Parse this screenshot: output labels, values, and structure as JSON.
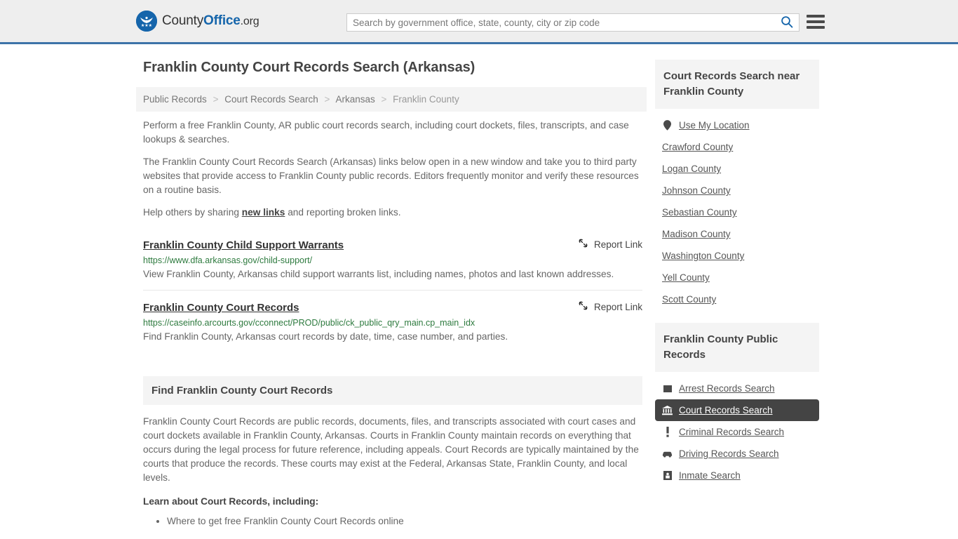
{
  "header": {
    "brand": {
      "part1": "County",
      "part2": "Office",
      "part3": ".org",
      "icon": "eagle-seal-logo"
    },
    "search": {
      "placeholder": "Search by government office, state, county, city or zip code",
      "value": "",
      "icon": "search-icon"
    },
    "menu_icon": "hamburger-menu-icon"
  },
  "page": {
    "title": "Franklin County Court Records Search (Arkansas)",
    "breadcrumb": [
      {
        "label": "Public Records",
        "current": false
      },
      {
        "label": "Court Records Search",
        "current": false
      },
      {
        "label": "Arkansas",
        "current": false
      },
      {
        "label": "Franklin County",
        "current": true
      }
    ],
    "breadcrumb_separator": ">",
    "intro": [
      "Perform a free Franklin County, AR public court records search, including court dockets, files, transcripts, and case lookups & searches.",
      "The Franklin County Court Records Search (Arkansas) links below open in a new window and take you to third party websites that provide access to Franklin County public records. Editors frequently monitor and verify these resources on a routine basis."
    ],
    "help_prefix": "Help others by sharing ",
    "help_link": "new links",
    "help_suffix": " and reporting broken links."
  },
  "results": {
    "report_label": "Report Link",
    "report_icon": "broken-link-icon",
    "items": [
      {
        "title": "Franklin County Child Support Warrants",
        "url": "https://www.dfa.arkansas.gov/child-support/",
        "description": "View Franklin County, Arkansas child support warrants list, including names, photos and last known addresses."
      },
      {
        "title": "Franklin County Court Records",
        "url": "https://caseinfo.arcourts.gov/cconnect/PROD/public/ck_public_qry_main.cp_main_idx",
        "description": "Find Franklin County, Arkansas court records by date, time, case number, and parties."
      }
    ]
  },
  "section": {
    "heading": "Find Franklin County Court Records",
    "body": "Franklin County Court Records are public records, documents, files, and transcripts associated with court cases and court dockets available in Franklin County, Arkansas. Courts in Franklin County maintain records on everything that occurs during the legal process for future reference, including appeals. Court Records are typically maintained by the courts that produce the records. These courts may exist at the Federal, Arkansas State, Franklin County, and local levels.",
    "learn_heading": "Learn about Court Records, including:",
    "learn_items": [
      "Where to get free Franklin County Court Records online"
    ]
  },
  "sidebar": {
    "nearby": {
      "title": "Court Records Search near Franklin County",
      "items": [
        {
          "label": "Use My Location",
          "icon": "map-pin-icon",
          "active": false
        },
        {
          "label": "Crawford County",
          "icon": "",
          "active": false
        },
        {
          "label": "Logan County",
          "icon": "",
          "active": false
        },
        {
          "label": "Johnson County",
          "icon": "",
          "active": false
        },
        {
          "label": "Sebastian County",
          "icon": "",
          "active": false
        },
        {
          "label": "Madison County",
          "icon": "",
          "active": false
        },
        {
          "label": "Washington County",
          "icon": "",
          "active": false
        },
        {
          "label": "Yell County",
          "icon": "",
          "active": false
        },
        {
          "label": "Scott County",
          "icon": "",
          "active": false
        }
      ]
    },
    "public_records": {
      "title": "Franklin County Public Records",
      "items": [
        {
          "label": "Arrest Records Search",
          "icon": "square-badge-icon",
          "active": false
        },
        {
          "label": "Court Records Search",
          "icon": "courthouse-icon",
          "active": true
        },
        {
          "label": "Criminal Records Search",
          "icon": "exclamation-icon",
          "active": false
        },
        {
          "label": "Driving Records Search",
          "icon": "car-icon",
          "active": false
        },
        {
          "label": "Inmate Search",
          "icon": "jail-building-icon",
          "active": false
        }
      ]
    }
  },
  "colors": {
    "header_bg": "#eeeeee",
    "header_border": "#3d73a8",
    "brand_blue": "#1565ab",
    "url_green": "#2d7a3e",
    "active_bg": "#444444",
    "panel_bg": "#f4f4f4"
  }
}
